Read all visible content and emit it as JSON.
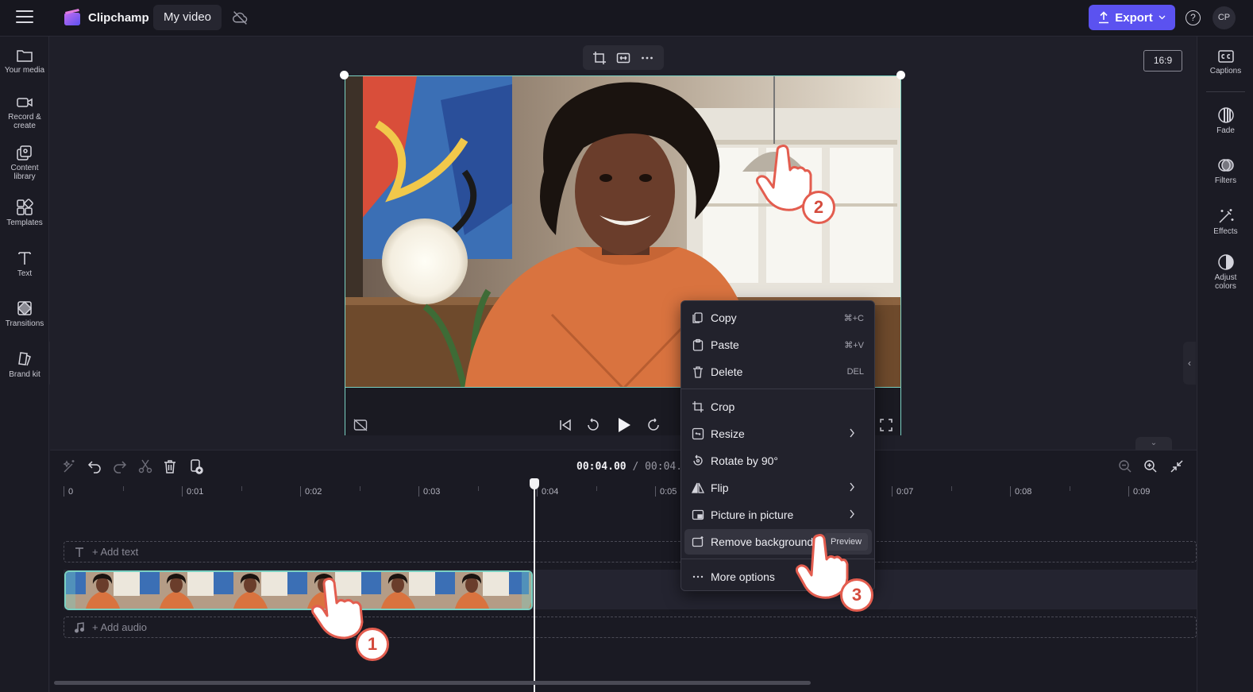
{
  "app": {
    "name": "Clipchamp",
    "project_name": "My video"
  },
  "toolbar": {
    "export_label": "Export",
    "help_label": "?",
    "avatar_initials": "CP"
  },
  "left_sidebar": {
    "items": [
      {
        "label": "Your media",
        "icon": "folder-icon"
      },
      {
        "label": "Record &\ncreate",
        "icon": "camera-icon"
      },
      {
        "label": "Content\nlibrary",
        "icon": "library-icon"
      },
      {
        "label": "Templates",
        "icon": "templates-icon"
      },
      {
        "label": "Text",
        "icon": "text-icon"
      },
      {
        "label": "Transitions",
        "icon": "transitions-icon"
      },
      {
        "label": "Brand kit",
        "icon": "brand-kit-icon"
      }
    ]
  },
  "right_sidebar": {
    "items": [
      {
        "label": "Captions",
        "icon": "captions-icon"
      },
      {
        "label": "Fade",
        "icon": "fade-icon"
      },
      {
        "label": "Filters",
        "icon": "filters-icon"
      },
      {
        "label": "Effects",
        "icon": "effects-icon"
      },
      {
        "label": "Adjust\ncolors",
        "icon": "adjust-colors-icon"
      }
    ]
  },
  "preview": {
    "aspect_ratio": "16:9"
  },
  "timeline": {
    "current_time": "00:04.00",
    "separator": "/",
    "total_time": "00:04.00",
    "ruler_labels": [
      "0",
      "0:01",
      "0:02",
      "0:03",
      "0:04",
      "0:05",
      "0:06",
      "0:07",
      "0:08",
      "0:09"
    ],
    "add_text_label": "+ Add text",
    "add_audio_label": "+ Add audio"
  },
  "context_menu": {
    "items": [
      {
        "label": "Copy",
        "shortcut": "⌘+C",
        "icon": "copy-icon"
      },
      {
        "label": "Paste",
        "shortcut": "⌘+V",
        "icon": "paste-icon"
      },
      {
        "label": "Delete",
        "shortcut": "DEL",
        "icon": "trash-icon"
      },
      {
        "label": "Crop",
        "icon": "crop-icon"
      },
      {
        "label": "Resize",
        "icon": "resize-icon",
        "submenu": true
      },
      {
        "label": "Rotate by 90°",
        "icon": "rotate-icon"
      },
      {
        "label": "Flip",
        "icon": "flip-icon",
        "submenu": true
      },
      {
        "label": "Picture in picture",
        "icon": "pip-icon",
        "submenu": true
      },
      {
        "label": "Remove background",
        "icon": "remove-background-icon",
        "badge": "Preview"
      },
      {
        "label": "More options",
        "icon": "more-icon"
      }
    ]
  },
  "annotations": {
    "steps": [
      "1",
      "2",
      "3"
    ]
  },
  "colors": {
    "accent": "#5b52f0",
    "selection": "#7ad1c2",
    "annotation": "#e35d4f"
  }
}
